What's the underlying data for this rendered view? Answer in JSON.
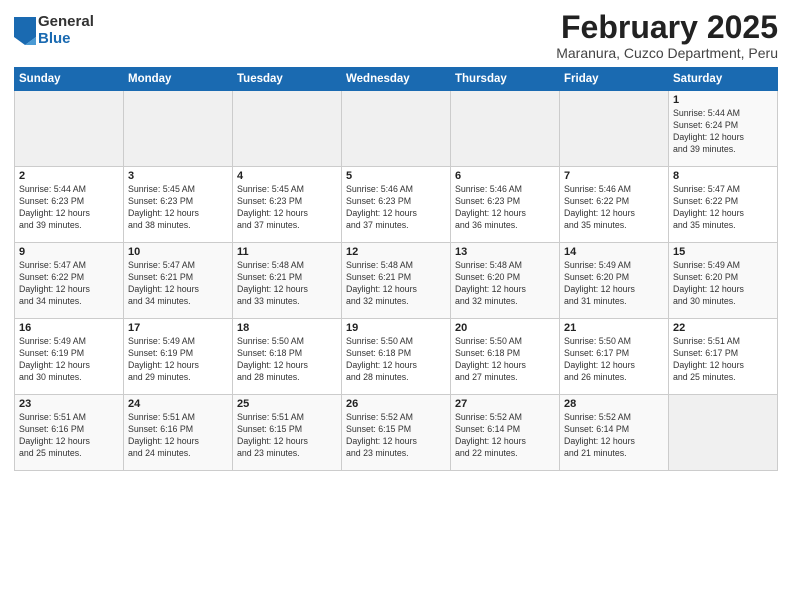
{
  "header": {
    "logo_general": "General",
    "logo_blue": "Blue",
    "title": "February 2025",
    "subtitle": "Maranura, Cuzco Department, Peru"
  },
  "days_of_week": [
    "Sunday",
    "Monday",
    "Tuesday",
    "Wednesday",
    "Thursday",
    "Friday",
    "Saturday"
  ],
  "weeks": [
    [
      {
        "day": "",
        "detail": ""
      },
      {
        "day": "",
        "detail": ""
      },
      {
        "day": "",
        "detail": ""
      },
      {
        "day": "",
        "detail": ""
      },
      {
        "day": "",
        "detail": ""
      },
      {
        "day": "",
        "detail": ""
      },
      {
        "day": "1",
        "detail": "Sunrise: 5:44 AM\nSunset: 6:24 PM\nDaylight: 12 hours\nand 39 minutes."
      }
    ],
    [
      {
        "day": "2",
        "detail": "Sunrise: 5:44 AM\nSunset: 6:23 PM\nDaylight: 12 hours\nand 39 minutes."
      },
      {
        "day": "3",
        "detail": "Sunrise: 5:45 AM\nSunset: 6:23 PM\nDaylight: 12 hours\nand 38 minutes."
      },
      {
        "day": "4",
        "detail": "Sunrise: 5:45 AM\nSunset: 6:23 PM\nDaylight: 12 hours\nand 37 minutes."
      },
      {
        "day": "5",
        "detail": "Sunrise: 5:46 AM\nSunset: 6:23 PM\nDaylight: 12 hours\nand 37 minutes."
      },
      {
        "day": "6",
        "detail": "Sunrise: 5:46 AM\nSunset: 6:23 PM\nDaylight: 12 hours\nand 36 minutes."
      },
      {
        "day": "7",
        "detail": "Sunrise: 5:46 AM\nSunset: 6:22 PM\nDaylight: 12 hours\nand 35 minutes."
      },
      {
        "day": "8",
        "detail": "Sunrise: 5:47 AM\nSunset: 6:22 PM\nDaylight: 12 hours\nand 35 minutes."
      }
    ],
    [
      {
        "day": "9",
        "detail": "Sunrise: 5:47 AM\nSunset: 6:22 PM\nDaylight: 12 hours\nand 34 minutes."
      },
      {
        "day": "10",
        "detail": "Sunrise: 5:47 AM\nSunset: 6:21 PM\nDaylight: 12 hours\nand 34 minutes."
      },
      {
        "day": "11",
        "detail": "Sunrise: 5:48 AM\nSunset: 6:21 PM\nDaylight: 12 hours\nand 33 minutes."
      },
      {
        "day": "12",
        "detail": "Sunrise: 5:48 AM\nSunset: 6:21 PM\nDaylight: 12 hours\nand 32 minutes."
      },
      {
        "day": "13",
        "detail": "Sunrise: 5:48 AM\nSunset: 6:20 PM\nDaylight: 12 hours\nand 32 minutes."
      },
      {
        "day": "14",
        "detail": "Sunrise: 5:49 AM\nSunset: 6:20 PM\nDaylight: 12 hours\nand 31 minutes."
      },
      {
        "day": "15",
        "detail": "Sunrise: 5:49 AM\nSunset: 6:20 PM\nDaylight: 12 hours\nand 30 minutes."
      }
    ],
    [
      {
        "day": "16",
        "detail": "Sunrise: 5:49 AM\nSunset: 6:19 PM\nDaylight: 12 hours\nand 30 minutes."
      },
      {
        "day": "17",
        "detail": "Sunrise: 5:49 AM\nSunset: 6:19 PM\nDaylight: 12 hours\nand 29 minutes."
      },
      {
        "day": "18",
        "detail": "Sunrise: 5:50 AM\nSunset: 6:18 PM\nDaylight: 12 hours\nand 28 minutes."
      },
      {
        "day": "19",
        "detail": "Sunrise: 5:50 AM\nSunset: 6:18 PM\nDaylight: 12 hours\nand 28 minutes."
      },
      {
        "day": "20",
        "detail": "Sunrise: 5:50 AM\nSunset: 6:18 PM\nDaylight: 12 hours\nand 27 minutes."
      },
      {
        "day": "21",
        "detail": "Sunrise: 5:50 AM\nSunset: 6:17 PM\nDaylight: 12 hours\nand 26 minutes."
      },
      {
        "day": "22",
        "detail": "Sunrise: 5:51 AM\nSunset: 6:17 PM\nDaylight: 12 hours\nand 25 minutes."
      }
    ],
    [
      {
        "day": "23",
        "detail": "Sunrise: 5:51 AM\nSunset: 6:16 PM\nDaylight: 12 hours\nand 25 minutes."
      },
      {
        "day": "24",
        "detail": "Sunrise: 5:51 AM\nSunset: 6:16 PM\nDaylight: 12 hours\nand 24 minutes."
      },
      {
        "day": "25",
        "detail": "Sunrise: 5:51 AM\nSunset: 6:15 PM\nDaylight: 12 hours\nand 23 minutes."
      },
      {
        "day": "26",
        "detail": "Sunrise: 5:52 AM\nSunset: 6:15 PM\nDaylight: 12 hours\nand 23 minutes."
      },
      {
        "day": "27",
        "detail": "Sunrise: 5:52 AM\nSunset: 6:14 PM\nDaylight: 12 hours\nand 22 minutes."
      },
      {
        "day": "28",
        "detail": "Sunrise: 5:52 AM\nSunset: 6:14 PM\nDaylight: 12 hours\nand 21 minutes."
      },
      {
        "day": "",
        "detail": ""
      }
    ]
  ]
}
